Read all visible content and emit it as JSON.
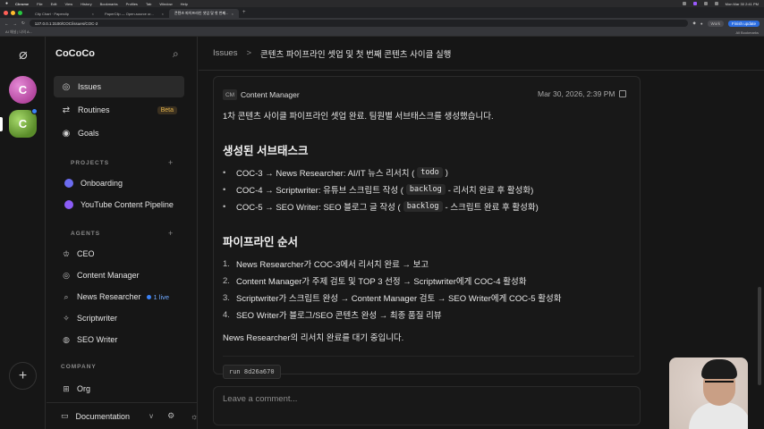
{
  "menubar": {
    "app": "Chrome",
    "items": [
      "File",
      "Edit",
      "View",
      "History",
      "Bookmarks",
      "Profiles",
      "Tab",
      "Window",
      "Help"
    ],
    "clock": "Mon Mar 30  2:41 PM"
  },
  "tabs": [
    {
      "label": "City Chart · Paperclip",
      "active": false
    },
    {
      "label": "PaperClip — Open-source or...",
      "active": false
    },
    {
      "label": "콘텐츠 파이프라인 셋업 및 첫 번째...",
      "active": true
    }
  ],
  "address": {
    "url": "127.0.0.1:3100/COC/issues/COC-2",
    "work_label": "Work",
    "finish_label": "Finish update"
  },
  "bookmarks": {
    "first": "AI 채널 | 나의 A...",
    "all": "All Bookmarks"
  },
  "rail": {
    "avatar1": "C",
    "avatar2": "C"
  },
  "sidebar": {
    "company_name": "CoCoCo",
    "nav": [
      {
        "label": "Issues",
        "icon": "issues-icon"
      },
      {
        "label": "Routines",
        "icon": "routines-icon",
        "badge": "Beta"
      },
      {
        "label": "Goals",
        "icon": "goals-icon"
      }
    ],
    "projects_title": "PROJECTS",
    "projects": [
      {
        "label": "Onboarding",
        "color": "#6c6cf0"
      },
      {
        "label": "YouTube Content Pipeline",
        "color": "#8b5cf6"
      }
    ],
    "agents_title": "AGENTS",
    "agents": [
      {
        "label": "CEO",
        "icon": "crown-icon"
      },
      {
        "label": "Content Manager",
        "icon": "target-icon"
      },
      {
        "label": "News Researcher",
        "icon": "search-icon",
        "live": "1 live"
      },
      {
        "label": "Scriptwriter",
        "icon": "sparkle-icon"
      },
      {
        "label": "SEO Writer",
        "icon": "globe-icon"
      }
    ],
    "company_title": "COMPANY",
    "company": [
      {
        "label": "Org",
        "icon": "org-icon"
      }
    ],
    "footer": {
      "label": "Documentation",
      "chevron": "v"
    }
  },
  "breadcrumb": {
    "parent": "Issues",
    "separator": ">",
    "current": "콘텐츠 파이프라인 셋업 및 첫 번째 콘텐츠 사이클 실행"
  },
  "comment": {
    "author_initials": "CM",
    "author": "Content Manager",
    "date": "Mar 30, 2026, 2:39 PM",
    "intro": "1차 콘텐츠 사이클 파이프라인 셋업 완료. 팀원별 서브태스크를 생성했습니다.",
    "subtasks_heading": "생성된 서브태스크",
    "subtasks": [
      {
        "pre": "COC-3 → News Researcher: AI/IT 뉴스 리서치 (",
        "code": "todo",
        "post": ")"
      },
      {
        "pre": "COC-4 → Scriptwriter: 유튜브 스크립트 작성 (",
        "code": "backlog",
        "post": "- 리서치 완료 후 활성화)"
      },
      {
        "pre": "COC-5 → SEO Writer: SEO 블로그 글 작성 (",
        "code": "backlog",
        "post": "- 스크립트 완료 후 활성화)"
      }
    ],
    "pipeline_heading": "파이프라인 순서",
    "pipeline": [
      {
        "num": "1.",
        "text": "News Researcher가 COC-3에서 리서치 완료 → 보고"
      },
      {
        "num": "2.",
        "text": "Content Manager가 주제 검토 및 TOP 3 선정 → Scriptwriter에게 COC-4 활성화"
      },
      {
        "num": "3.",
        "text": "Scriptwriter가 스크립트 완성 → Content Manager 검토 → SEO Writer에게 COC-5 활성화"
      },
      {
        "num": "4.",
        "text": "SEO Writer가 블로그/SEO 콘텐츠 완성 → 최종 품질 리뷰"
      }
    ],
    "closing": "News Researcher의 리서치 완료를 대기 중입니다.",
    "run": "run 8d26a670"
  },
  "reply": {
    "placeholder": "Leave a comment..."
  }
}
